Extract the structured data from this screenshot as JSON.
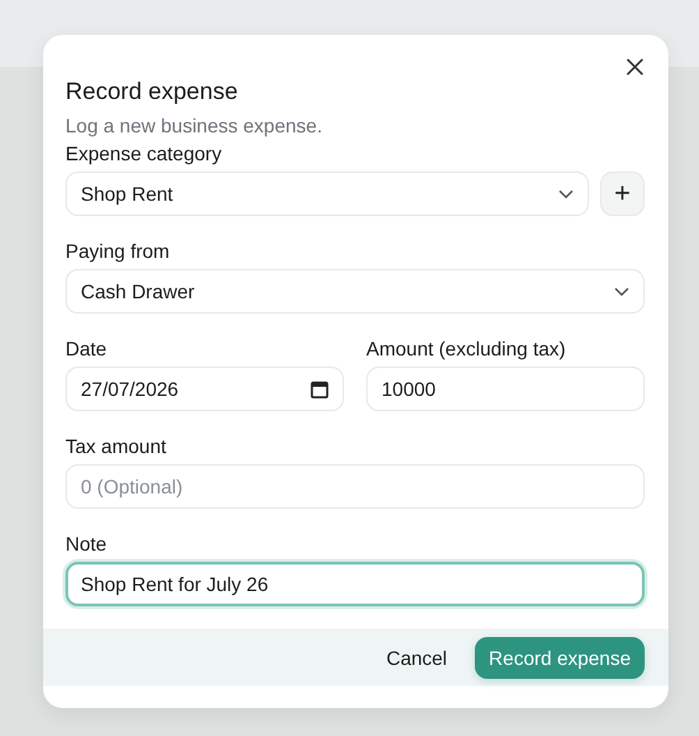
{
  "dialog": {
    "title": "Record expense",
    "subtitle": "Log a new business expense.",
    "fields": [
      {
        "kind": "select",
        "label": "Expense category",
        "value": "Shop Rent",
        "add_button": "+"
      },
      {
        "kind": "select",
        "label": "Paying from",
        "value": "Cash Drawer"
      },
      {
        "kind": "date",
        "label": "Date",
        "value": "27/07/2026",
        "half": true
      },
      {
        "kind": "text",
        "label": "Amount (excluding tax)",
        "value": "10000",
        "half": true
      },
      {
        "kind": "text",
        "label": "Tax amount",
        "placeholder": "0 (Optional)"
      },
      {
        "kind": "text",
        "label": "Note",
        "value": "Shop Rent for July 26",
        "focused": true
      }
    ],
    "buttons": [
      {
        "label": "Cancel",
        "primary": false
      },
      {
        "label": "Record expense",
        "primary": true
      }
    ]
  }
}
